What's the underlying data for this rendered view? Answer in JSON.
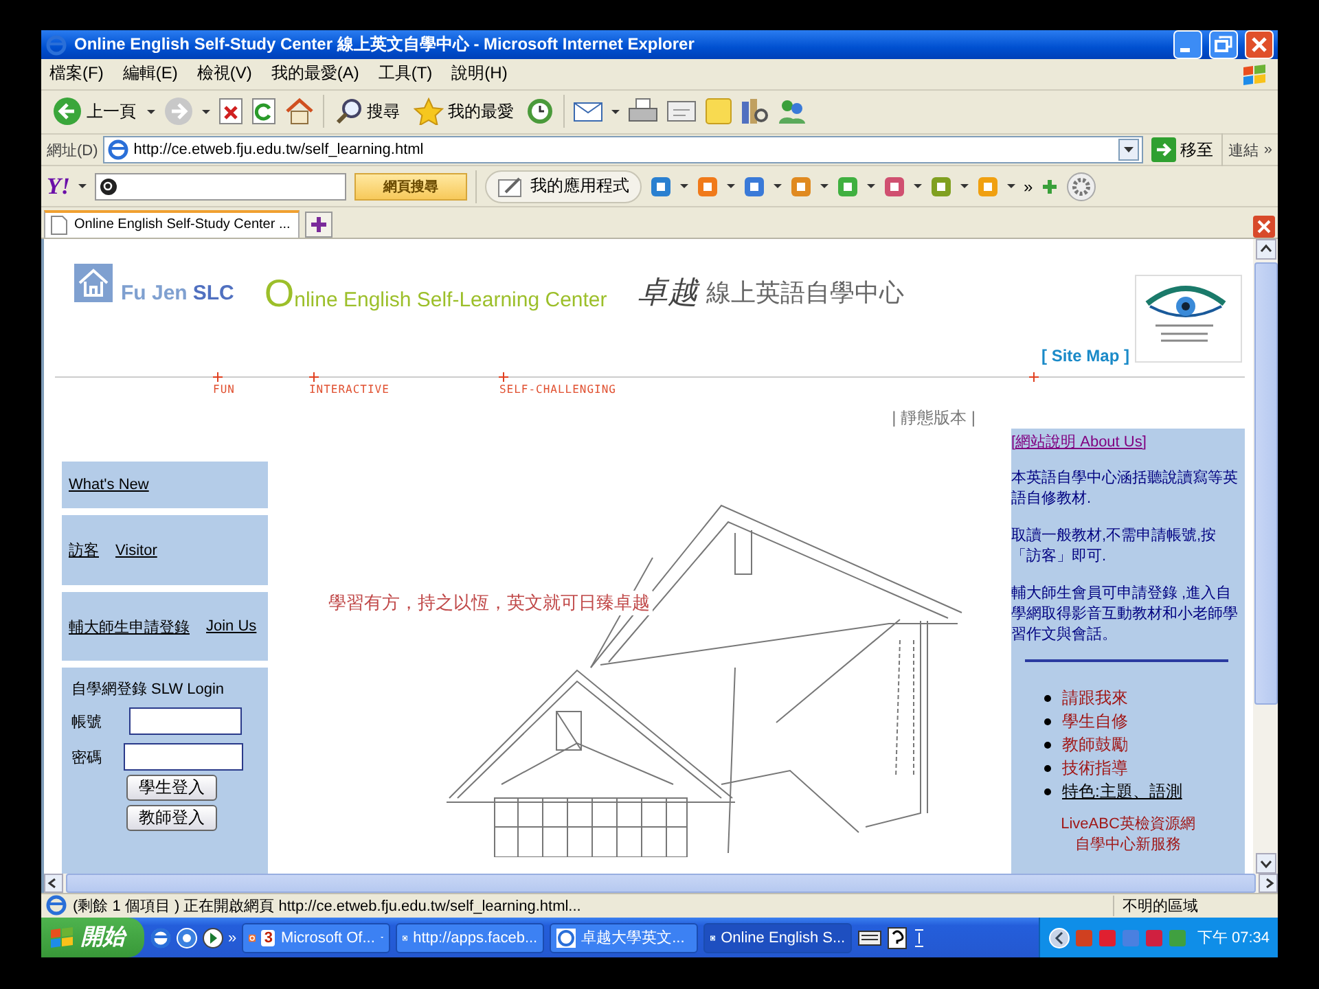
{
  "window": {
    "title": "Online English Self-Study Center 線上英文自學中心 - Microsoft Internet Explorer"
  },
  "menu_bar": [
    "檔案(F)",
    "編輯(E)",
    "檢視(V)",
    "我的最愛(A)",
    "工具(T)",
    "說明(H)"
  ],
  "toolbar": {
    "back": "上一頁",
    "search": "搜尋",
    "favorites": "我的最愛"
  },
  "address_bar": {
    "label": "網址(D)",
    "value": "http://ce.etweb.fju.edu.tw/self_learning.html",
    "go": "移至",
    "links": "連結",
    "more": "»"
  },
  "yahoo_toolbar": {
    "logo": "Y!",
    "search_button": "網頁搜尋",
    "apps": "我的應用程式",
    "more": "»"
  },
  "tabs": [
    {
      "label": "Online English Self-Study Center ...",
      "selected": true
    }
  ],
  "page": {
    "logo": {
      "name": "Fu Jen",
      "suffix": "SLC"
    },
    "site_title": "Online English Self-Learning Center",
    "brand": "卓越",
    "subtitle": "線上英語自學中心",
    "site_map": "[ Site Map ]",
    "taglines": [
      "FUN",
      "INTERACTIVE",
      "SELF-CHALLENGING"
    ],
    "static_version": "| 靜態版本 |",
    "sidebar": [
      {
        "links": [
          "What's New"
        ]
      },
      {
        "links": [
          "訪客",
          "Visitor"
        ]
      },
      {
        "links": [
          "輔大師生申請登錄",
          "Join Us"
        ]
      }
    ],
    "login": {
      "title": "自學網登錄 SLW Login",
      "fields": [
        {
          "label": "帳號"
        },
        {
          "label": "密碼"
        }
      ],
      "buttons": [
        "學生登入",
        "教師登入"
      ]
    },
    "slogan": "學習有方，持之以恆，英文就可日臻卓越",
    "about": {
      "heading": "[網站說明 About Us]",
      "paragraphs": [
        "本英語自學中心涵括聽說讀寫等英語自修教材.",
        "取讀一般教材,不需申請帳號,按「訪客」即可.",
        "輔大師生會員可申請登錄 ,進入自學網取得影音互動教材和小老師學習作文與會話。"
      ],
      "menu": [
        {
          "label": "請跟我來",
          "visited": false
        },
        {
          "label": "學生自修",
          "visited": false
        },
        {
          "label": "教師鼓勵",
          "visited": false
        },
        {
          "label": "技術指導",
          "visited": false
        },
        {
          "label": "特色:主題、語測",
          "visited": true
        }
      ],
      "news": [
        "LiveABC英檢資源網",
        "自學中心新服務"
      ]
    }
  },
  "status_bar": {
    "text": "(剩餘 1 個項目 ) 正在開啟網頁 http://ce.etweb.fju.edu.tw/self_learning.html...",
    "zone": "不明的區域"
  },
  "taskbar": {
    "start": "開始",
    "more": "»",
    "tasks": [
      {
        "count": "3",
        "label": "Microsoft Of...",
        "selected": false
      },
      {
        "label": "http://apps.faceb...",
        "selected": false
      },
      {
        "label": "卓越大學英文...",
        "selected": false
      },
      {
        "label": "Online English S...",
        "selected": true
      }
    ],
    "clock": "下午 07:34"
  }
}
